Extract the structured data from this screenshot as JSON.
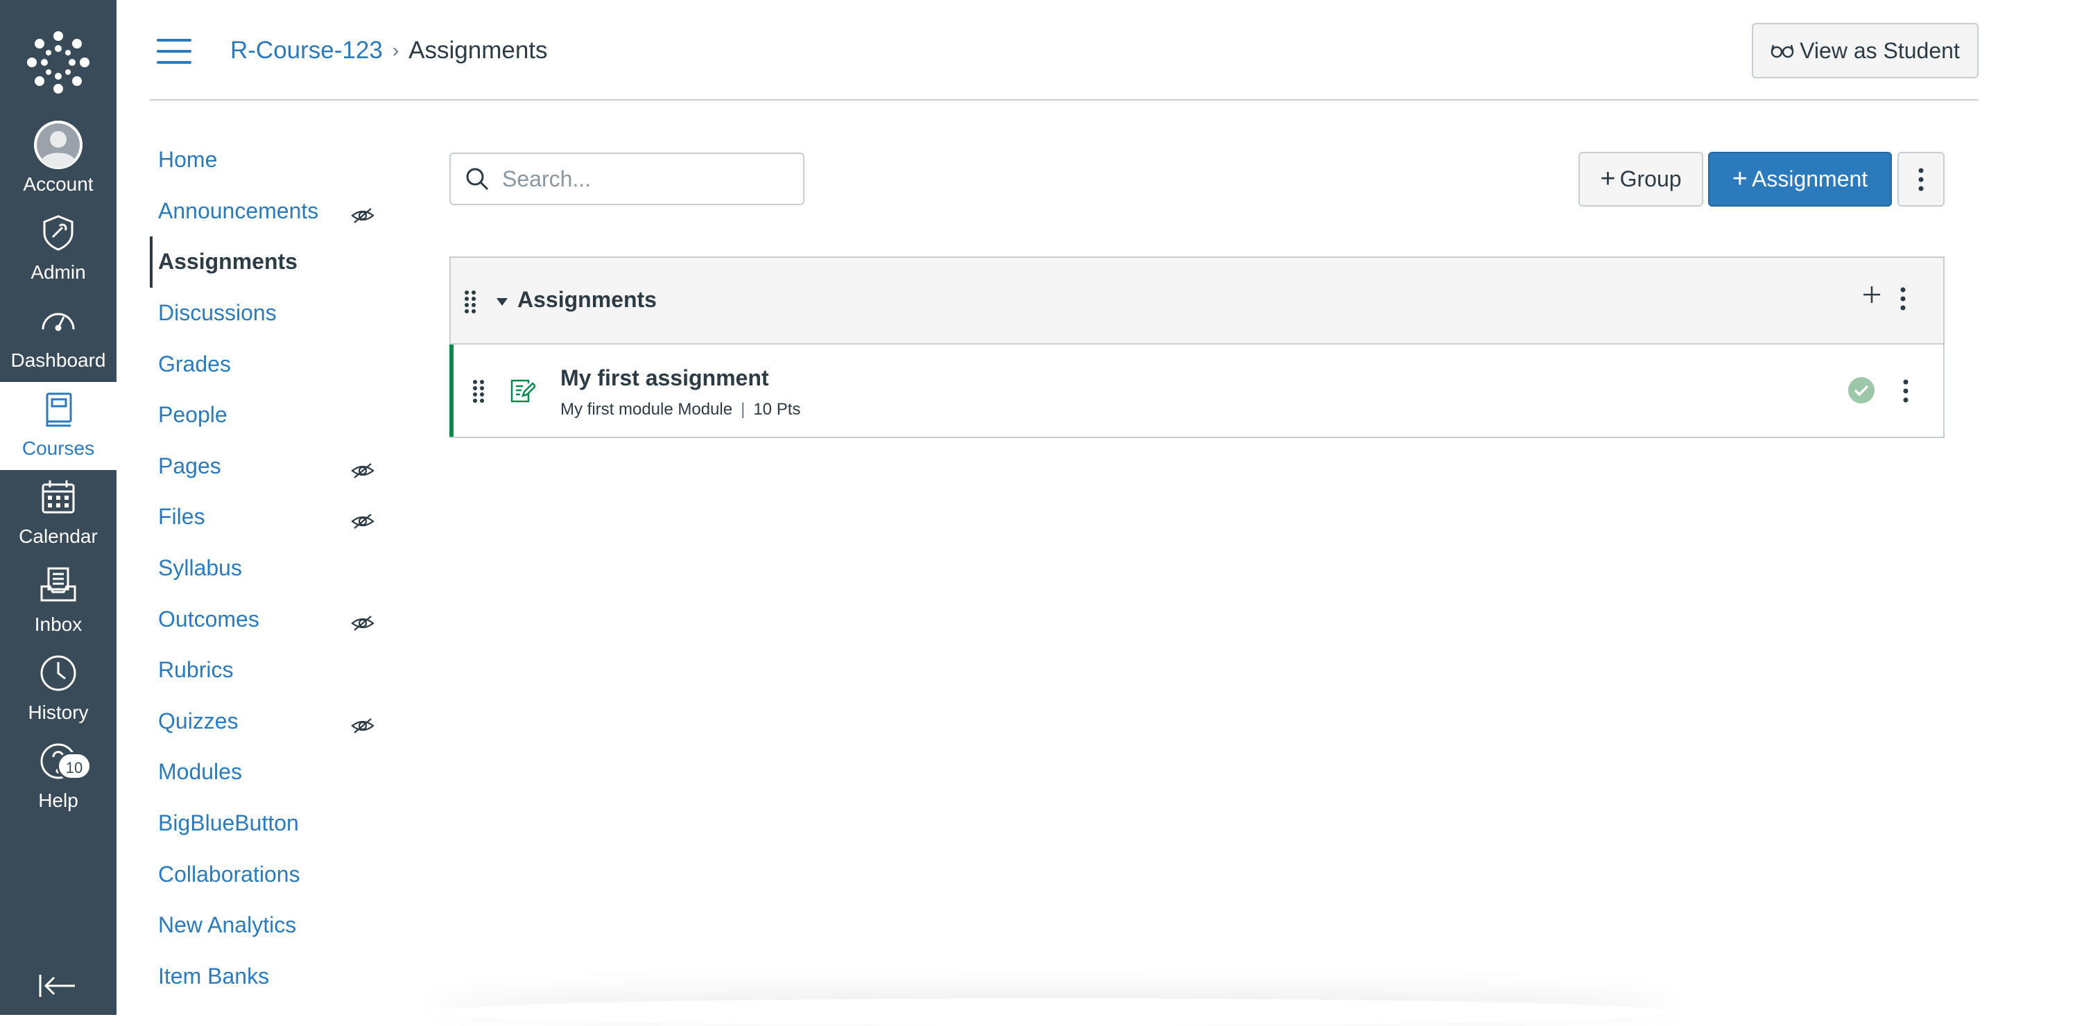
{
  "global_nav": {
    "items": [
      {
        "label": "Account",
        "icon": "account-icon"
      },
      {
        "label": "Admin",
        "icon": "admin-icon"
      },
      {
        "label": "Dashboard",
        "icon": "dashboard-icon"
      },
      {
        "label": "Courses",
        "icon": "courses-icon",
        "active": true
      },
      {
        "label": "Calendar",
        "icon": "calendar-icon"
      },
      {
        "label": "Inbox",
        "icon": "inbox-icon"
      },
      {
        "label": "History",
        "icon": "history-icon"
      },
      {
        "label": "Help",
        "icon": "help-icon"
      }
    ],
    "help_badge": "10",
    "colors": {
      "nav_bg": "#394b58",
      "active_text": "#2b7abc"
    }
  },
  "header": {
    "breadcrumb": {
      "course": "R-Course-123",
      "current": "Assignments"
    },
    "view_as_student": "View as Student"
  },
  "course_nav": {
    "items": [
      {
        "label": "Home",
        "hidden": false
      },
      {
        "label": "Announcements",
        "hidden": true
      },
      {
        "label": "Assignments",
        "hidden": false,
        "active": true
      },
      {
        "label": "Discussions",
        "hidden": false
      },
      {
        "label": "Grades",
        "hidden": false
      },
      {
        "label": "People",
        "hidden": false
      },
      {
        "label": "Pages",
        "hidden": true
      },
      {
        "label": "Files",
        "hidden": true
      },
      {
        "label": "Syllabus",
        "hidden": false
      },
      {
        "label": "Outcomes",
        "hidden": true
      },
      {
        "label": "Rubrics",
        "hidden": false
      },
      {
        "label": "Quizzes",
        "hidden": true
      },
      {
        "label": "Modules",
        "hidden": false
      },
      {
        "label": "BigBlueButton",
        "hidden": false
      },
      {
        "label": "Collaborations",
        "hidden": false
      },
      {
        "label": "New Analytics",
        "hidden": false
      },
      {
        "label": "Item Banks",
        "hidden": false
      }
    ]
  },
  "toolbar": {
    "search_placeholder": "Search...",
    "group_button": "Group",
    "assignment_button": "Assignment",
    "colors": {
      "primary": "#2b7abc"
    }
  },
  "assignment_group": {
    "title": "Assignments",
    "assignments": [
      {
        "title": "My first assignment",
        "module": "My first module Module",
        "points": "10 Pts",
        "published": true
      }
    ],
    "colors": {
      "published_border": "#0b874b",
      "published_icon": "#9cc7a8"
    }
  }
}
